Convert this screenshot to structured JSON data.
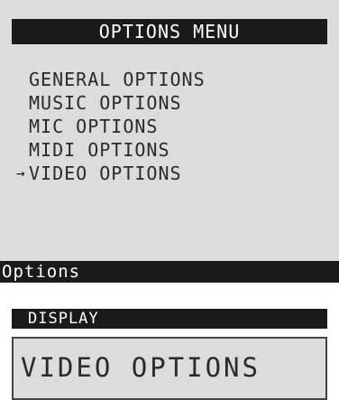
{
  "screen": {
    "title": "OPTIONS MENU",
    "menu_items": [
      {
        "label": "GENERAL OPTIONS",
        "cursor": ""
      },
      {
        "label": "MUSIC OPTIONS",
        "cursor": ""
      },
      {
        "label": "MIC OPTIONS",
        "cursor": ""
      },
      {
        "label": "MIDI OPTIONS",
        "cursor": ""
      },
      {
        "label": "VIDEO OPTIONS",
        "cursor": "→"
      }
    ],
    "status": "Options"
  },
  "display": {
    "label": "DISPLAY",
    "value": "VIDEO OPTIONS"
  },
  "colors": {
    "screen_background": "#dcdcdc",
    "bar_background": "#1a1a1a",
    "bar_text": "#ffffff",
    "text": "#2a2a2a"
  },
  "icons": {
    "selection_cursor": "arrow-right-icon"
  }
}
